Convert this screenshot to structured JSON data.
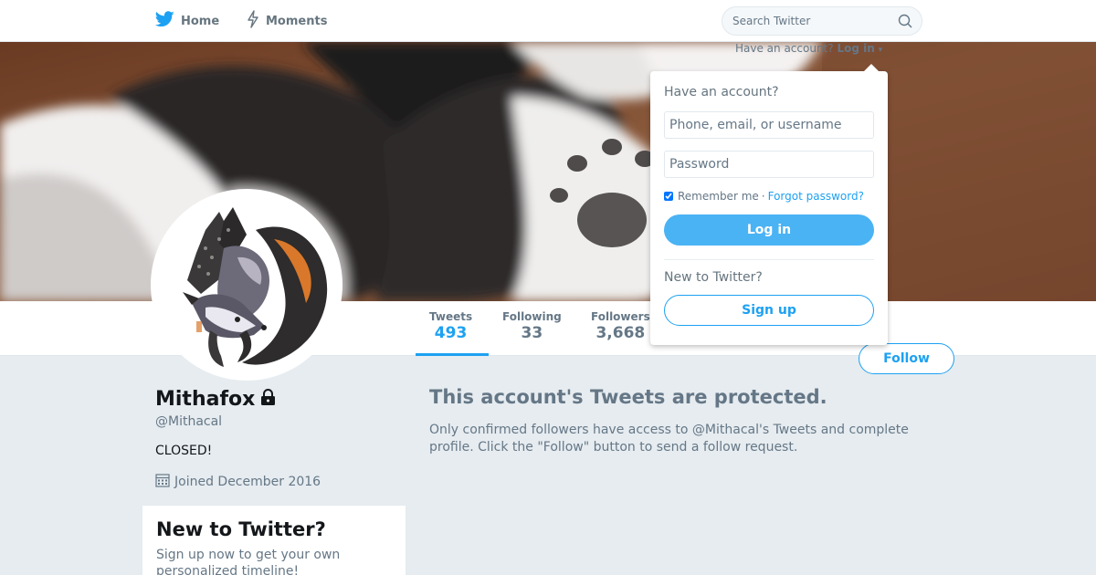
{
  "nav": {
    "home_label": "Home",
    "moments_label": "Moments",
    "search_placeholder": "Search Twitter"
  },
  "login_hint": {
    "text": "Have an account?",
    "link": "Log in"
  },
  "login_dropdown": {
    "heading": "Have an account?",
    "username_placeholder": "Phone, email, or username",
    "password_placeholder": "Password",
    "remember_label": "Remember me",
    "separator": "·",
    "forgot_label": "Forgot password?",
    "login_button": "Log in",
    "new_heading": "New to Twitter?",
    "signup_button": "Sign up"
  },
  "profile": {
    "name": "Mithafox",
    "handle": "@Mithacal",
    "bio": "CLOSED!",
    "joined": "Joined December 2016",
    "stats": [
      {
        "label": "Tweets",
        "value": "493"
      },
      {
        "label": "Following",
        "value": "33"
      },
      {
        "label": "Followers",
        "value": "3,668"
      }
    ],
    "follow_button": "Follow"
  },
  "protected": {
    "title": "This account's Tweets are protected.",
    "text": "Only confirmed followers have access to @Mithacal's Tweets and complete profile. Click the \"Follow\" button to send a follow request."
  },
  "signup_card": {
    "title": "New to Twitter?",
    "text": "Sign up now to get your own personalized timeline!"
  },
  "colors": {
    "accent": "#1da1f2",
    "background": "#e6ecf0",
    "muted_text": "#657786"
  },
  "icons": [
    "twitter-bird-icon",
    "moments-icon",
    "search-icon",
    "lock-icon",
    "calendar-icon",
    "caret-down-icon"
  ]
}
